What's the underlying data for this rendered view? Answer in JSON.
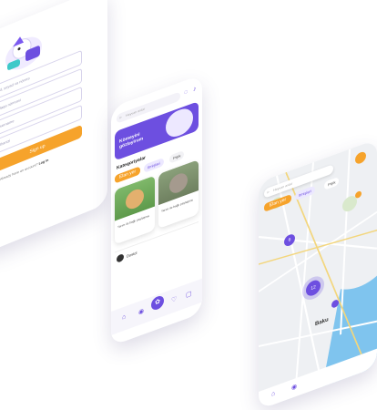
{
  "login": {
    "field1_placeholder": "Ad, soyad və nömrə",
    "field2_placeholder": "Əlaqə nömrəsi",
    "field3_placeholder": "Username",
    "field4_placeholder": "Şifrənizi",
    "signup_label": "Sign up",
    "footer_text": "Already have an account?",
    "footer_link": "Log in"
  },
  "home": {
    "search_placeholder": "Heyvan axtar",
    "banner_text": "Kömeyini gözləyirəm",
    "categories_title": "Kateqoriyalar",
    "add_button": "Elan yer",
    "chips": [
      "Itmişləri",
      "Pişik",
      "Xidmət"
    ],
    "post1_caption": "Yarım ilə bağlı paylaşma",
    "post2_caption": "Yarım ilə bağlı paylaşma",
    "user_label": "Dostol"
  },
  "map": {
    "search_placeholder": "Heyvan axtar",
    "add_button": "Elan yer",
    "chips": [
      "Itmişləri",
      "Pişik",
      "Xidmət"
    ],
    "city_label": "Baku",
    "cluster1": "6",
    "cluster2": "12"
  },
  "colors": {
    "accent": "#6d4fe0",
    "orange": "#f6a32b",
    "bg": "#ffffff"
  }
}
